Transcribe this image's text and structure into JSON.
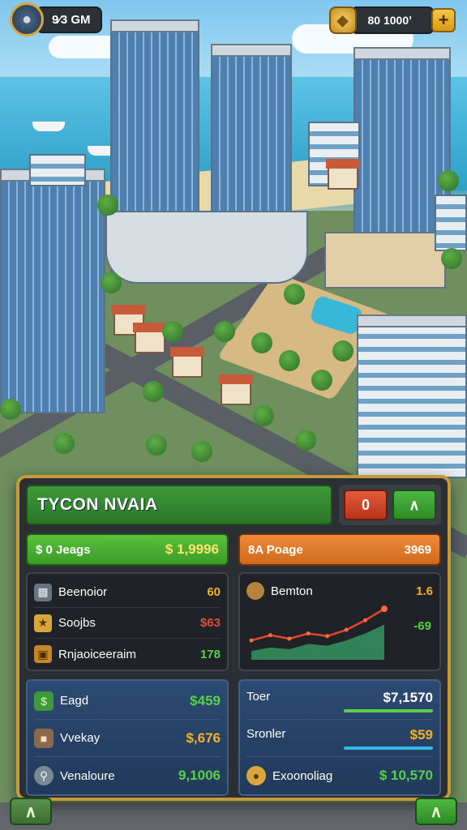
{
  "hud": {
    "player_value": "9⁄3 GM",
    "currency_value": "80 1000ʼ",
    "plus_label": "+",
    "avatar_icon": "player-avatar-icon",
    "coin_icon": "gold-bar-icon"
  },
  "panel": {
    "title": "TYCON NVAIA",
    "btn_red_label": "0",
    "btn_green_label": "∧",
    "green_bar": {
      "label": "$ 0 Jeags",
      "value": "$ 1,9996"
    },
    "orange_bar": {
      "label": "8A Poage",
      "value": "3969"
    },
    "left_stats": [
      {
        "icon": "money-stack-icon",
        "label": "Beenoior",
        "value": "60",
        "color": "#f0b32a"
      },
      {
        "icon": "gold-coin-icon",
        "label": "Soojbs",
        "value": "$63",
        "color": "#e34a3a"
      },
      {
        "icon": "chest-icon",
        "label": "Rnjaoiceeraim",
        "value": "178",
        "color": "#58d14a"
      }
    ],
    "chart": {
      "icon": "bronze-coin-icon",
      "label": "Bemton",
      "value_top": "1.6",
      "value_side": "-69"
    },
    "bottom_left": [
      {
        "icon": "cash-icon",
        "label": "Eagd",
        "value": "$459",
        "color": "#58d14a"
      },
      {
        "icon": "crate-icon",
        "label": "Vvekay",
        "value": "$,676",
        "color": "#f0b32a"
      },
      {
        "icon": "magnifier-icon",
        "label": "Venaloure",
        "value": "9,1006",
        "color": "#58d14a"
      }
    ],
    "bottom_right": [
      {
        "label": "Toer",
        "value": "$7,1570",
        "color": "#ffffff",
        "meter_color": "#58d14a"
      },
      {
        "label": "Sronler",
        "value": "$59",
        "color": "#f0b32a",
        "meter_color": "#36b7e8"
      },
      {
        "icon": "coin-stack-icon",
        "label": "Exoonoliag",
        "value": "$ 10,570",
        "color": "#58d14a"
      }
    ]
  },
  "chart_data": {
    "type": "line",
    "x": [
      1,
      2,
      3,
      4,
      5,
      6,
      7,
      8
    ],
    "series": [
      {
        "values": [
          22,
          28,
          24,
          30,
          27,
          34,
          45,
          58
        ]
      }
    ],
    "area_values": [
      10,
      14,
      12,
      18,
      16,
      22,
      30,
      40
    ],
    "colors": {
      "line": "#e4472c",
      "area": "#3aa36a",
      "marker": "#ff6a3a"
    }
  }
}
